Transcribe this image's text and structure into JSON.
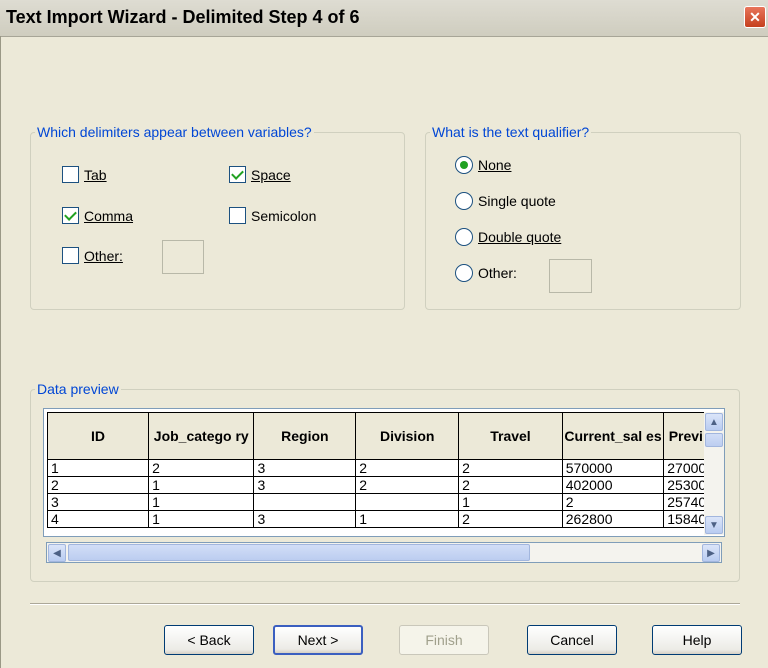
{
  "window": {
    "title": "Text Import Wizard - Delimited Step 4 of 6",
    "close_glyph": "✕"
  },
  "delimiters": {
    "legend": "Which delimiters appear between variables?",
    "items": [
      {
        "label": "Tab",
        "checked": false
      },
      {
        "label": "Space",
        "checked": true
      },
      {
        "label": "Comma",
        "checked": true
      },
      {
        "label": "Semicolon",
        "checked": false
      },
      {
        "label": "Other:",
        "checked": false
      }
    ]
  },
  "qualifier": {
    "legend": "What is the text qualifier?",
    "options": [
      "None",
      "Single quote",
      "Double quote",
      "Other:"
    ],
    "selected": "None"
  },
  "preview": {
    "legend": "Data preview",
    "columns": [
      "ID",
      "Job_catego ry",
      "Region",
      "Division",
      "Travel",
      "Current_sal es",
      "Previ al"
    ],
    "rows": [
      [
        "1",
        "2",
        "3",
        "2",
        "2",
        "570000",
        "27000"
      ],
      [
        "2",
        "1",
        "3",
        "2",
        "2",
        "402000",
        "25300"
      ],
      [
        "3",
        "1",
        "",
        "",
        "1",
        "2",
        "25740"
      ],
      [
        "4",
        "1",
        "3",
        "1",
        "2",
        "262800",
        "15840"
      ]
    ]
  },
  "buttons": {
    "back": "< Back",
    "next": "Next >",
    "finish": "Finish",
    "cancel": "Cancel",
    "help": "Help"
  }
}
